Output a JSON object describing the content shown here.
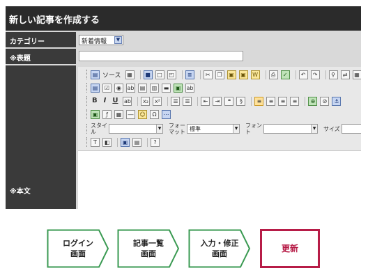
{
  "page": {
    "title": "新しい記事を作成する"
  },
  "form": {
    "category": {
      "label": "カテゴリー",
      "value": "新着情報"
    },
    "title": {
      "label": "※表題",
      "value": ""
    },
    "body": {
      "label": "※本文"
    }
  },
  "editor": {
    "source_label": "ソース",
    "style_label": "スタイル",
    "format_label": "フォーマット",
    "format_value": "標準",
    "font_label": "フォント",
    "size_label": "サイズ",
    "bold": "B",
    "italic": "I",
    "underline": "U"
  },
  "steps": [
    {
      "line1": "ログイン",
      "line2": "画面",
      "color": "#3a9a52"
    },
    {
      "line1": "記事一覧",
      "line2": "画面",
      "color": "#3a9a52"
    },
    {
      "line1": "入力・修正",
      "line2": "画面",
      "color": "#3a9a52"
    },
    {
      "line1": "更新",
      "line2": "",
      "color": "#b71c47"
    }
  ]
}
